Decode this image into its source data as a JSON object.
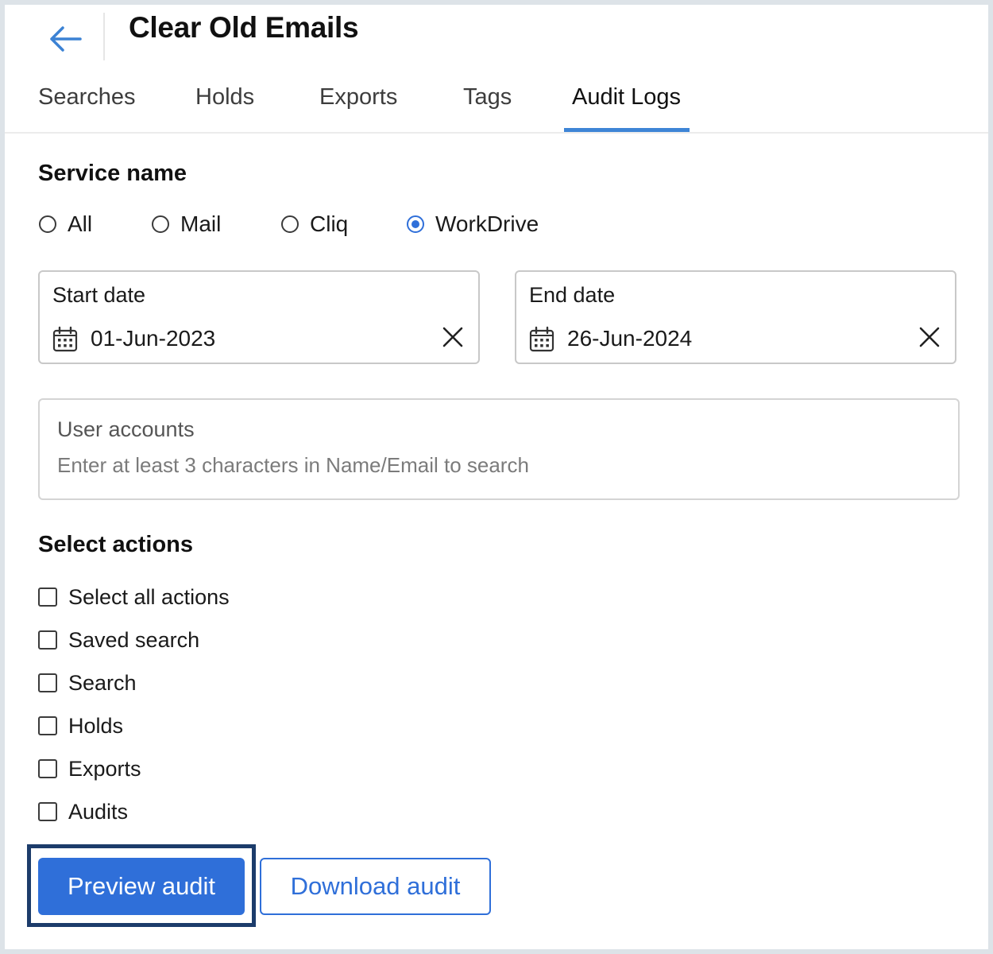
{
  "header": {
    "title": "Clear Old Emails",
    "back_icon": "arrow-left-icon"
  },
  "tabs": [
    {
      "label": "Searches",
      "active": false
    },
    {
      "label": "Holds",
      "active": false
    },
    {
      "label": "Exports",
      "active": false
    },
    {
      "label": "Tags",
      "active": false
    },
    {
      "label": "Audit Logs",
      "active": true
    }
  ],
  "service": {
    "heading": "Service name",
    "options": [
      {
        "label": "All",
        "checked": false
      },
      {
        "label": "Mail",
        "checked": false
      },
      {
        "label": "Cliq",
        "checked": false
      },
      {
        "label": "WorkDrive",
        "checked": true
      }
    ]
  },
  "start_date": {
    "label": "Start date",
    "value": "01-Jun-2023",
    "icon": "calendar-icon",
    "clear_icon": "close-icon"
  },
  "end_date": {
    "label": "End date",
    "value": "26-Jun-2024",
    "icon": "calendar-icon",
    "clear_icon": "close-icon"
  },
  "user_accounts": {
    "label": "User accounts",
    "placeholder": "Enter at least 3 characters in Name/Email to search",
    "value": ""
  },
  "actions": {
    "heading": "Select actions",
    "items": [
      {
        "label": "Select all actions",
        "checked": false
      },
      {
        "label": "Saved search",
        "checked": false
      },
      {
        "label": "Search",
        "checked": false
      },
      {
        "label": "Holds",
        "checked": false
      },
      {
        "label": "Exports",
        "checked": false
      },
      {
        "label": "Audits",
        "checked": false
      }
    ]
  },
  "buttons": {
    "preview_label": "Preview audit",
    "download_label": "Download audit"
  },
  "colors": {
    "accent": "#2f6fd9",
    "tab_underline": "#3e85d6",
    "focus_ring": "#1c3c6b",
    "background": "#dde3e8"
  }
}
